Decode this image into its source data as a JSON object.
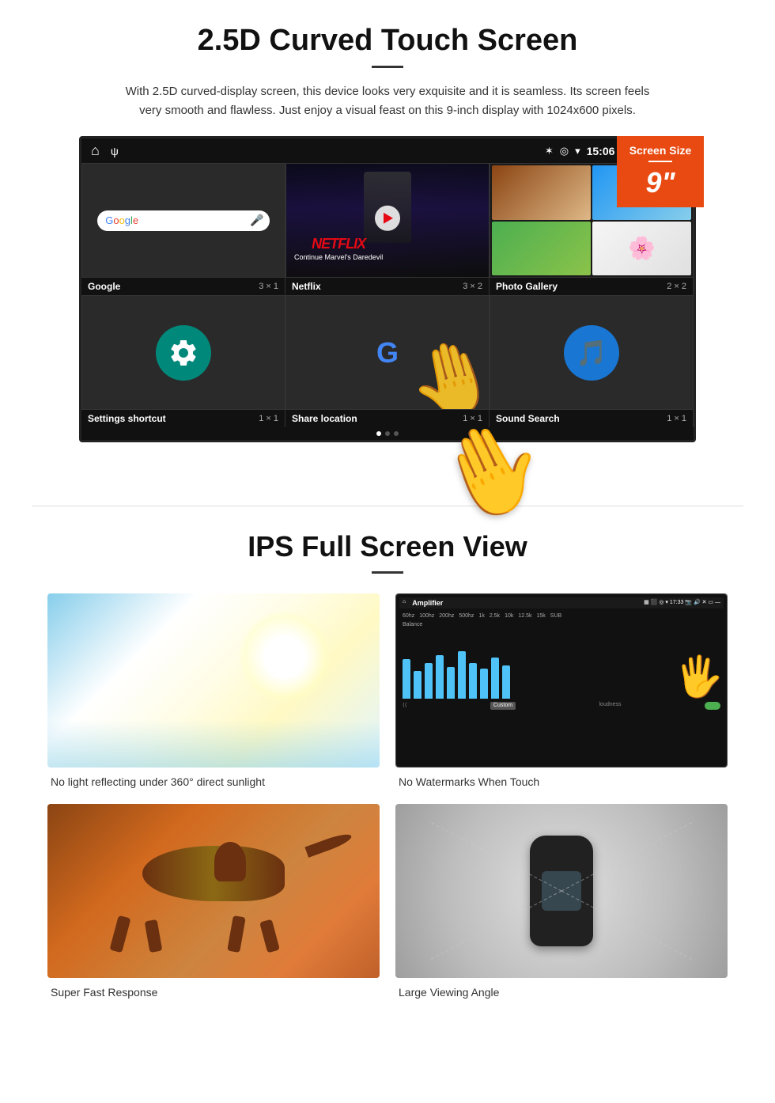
{
  "section1": {
    "title": "2.5D Curved Touch Screen",
    "description": "With 2.5D curved-display screen, this device looks very exquisite and it is seamless. Its screen feels very smooth and flawless. Just enjoy a visual feast on this 9-inch display with 1024x600 pixels.",
    "screen_badge": {
      "title": "Screen Size",
      "size": "9\""
    },
    "status_bar": {
      "time": "15:06"
    },
    "apps_row1": [
      {
        "name": "Google",
        "size": "3 × 1"
      },
      {
        "name": "Netflix",
        "size": "3 × 2"
      },
      {
        "name": "Photo Gallery",
        "size": "2 × 2"
      }
    ],
    "apps_row2": [
      {
        "name": "Settings shortcut",
        "size": "1 × 1"
      },
      {
        "name": "Share location",
        "size": "1 × 1"
      },
      {
        "name": "Sound Search",
        "size": "1 × 1"
      }
    ],
    "netflix": {
      "logo": "NETFLIX",
      "subtitle": "Continue Marvel's Daredevil"
    }
  },
  "section2": {
    "title": "IPS Full Screen View",
    "features": [
      {
        "id": "sunlight",
        "caption": "No light reflecting under 360° direct sunlight"
      },
      {
        "id": "amplifier",
        "caption": "No Watermarks When Touch"
      },
      {
        "id": "cheetah",
        "caption": "Super Fast Response"
      },
      {
        "id": "car",
        "caption": "Large Viewing Angle"
      }
    ]
  }
}
